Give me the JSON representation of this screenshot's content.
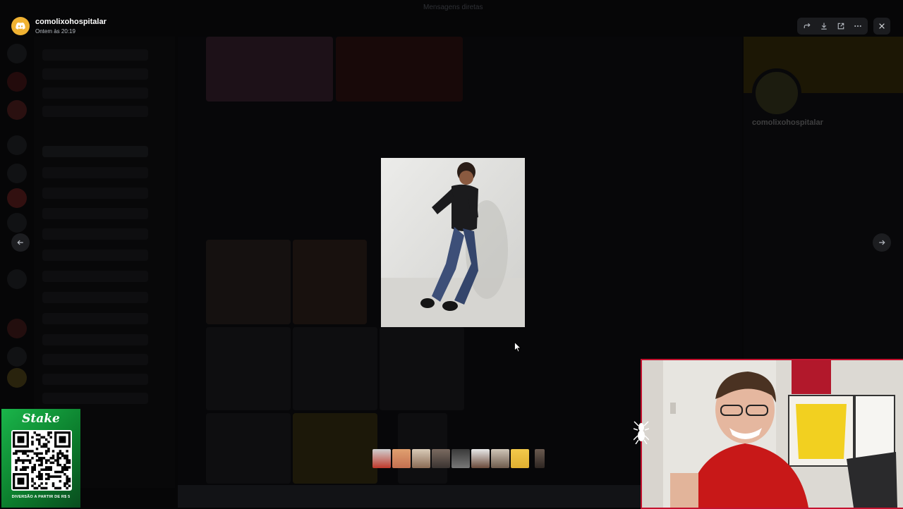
{
  "window": {
    "title": "Mensagens diretas"
  },
  "header": {
    "username": "comolixohospitalar",
    "timestamp": "Ontem às 20:19"
  },
  "toolbar": {
    "forward_icon": "forward-icon",
    "download_icon": "download-icon",
    "open_external_icon": "open-external-icon",
    "more_icon": "more-icon",
    "close_icon": "close-icon"
  },
  "viewer": {
    "prev_icon": "arrow-left-icon",
    "next_icon": "arrow-right-icon",
    "thumbnail_count": 9
  },
  "background_profile": {
    "name": "comolixohospitalar"
  },
  "stake_ad": {
    "brand": "Stake",
    "tagline": "DIVERSÃO A PARTIR DE R$ 5"
  },
  "colors": {
    "accent_server": "#f0b232",
    "webcam_border": "#c4122f",
    "stake_green": "#1ab54a"
  }
}
